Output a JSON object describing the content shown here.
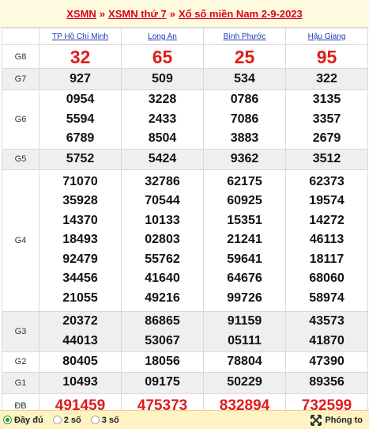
{
  "header": {
    "link1": "XSMN",
    "sep1": "»",
    "link2": "XSMN thứ 7",
    "sep2": "»",
    "link3": "Xổ số miền Nam 2-9-2023"
  },
  "provinces": [
    "TP Hồ Chí Minh",
    "Long An",
    "Bình Phước",
    "Hậu Giang"
  ],
  "prizes": [
    {
      "label": "G8",
      "rows": [
        [
          "32",
          "65",
          "25",
          "95"
        ]
      ]
    },
    {
      "label": "G7",
      "rows": [
        [
          "927",
          "509",
          "534",
          "322"
        ]
      ]
    },
    {
      "label": "G6",
      "rows": [
        [
          "0954",
          "3228",
          "0786",
          "3135"
        ],
        [
          "5594",
          "2433",
          "7086",
          "3357"
        ],
        [
          "6789",
          "8504",
          "3883",
          "2679"
        ]
      ]
    },
    {
      "label": "G5",
      "rows": [
        [
          "5752",
          "5424",
          "9362",
          "3512"
        ]
      ]
    },
    {
      "label": "G4",
      "rows": [
        [
          "71070",
          "32786",
          "62175",
          "62373"
        ],
        [
          "35928",
          "70544",
          "60925",
          "19574"
        ],
        [
          "14370",
          "10133",
          "15351",
          "14272"
        ],
        [
          "18493",
          "02803",
          "21241",
          "46113"
        ],
        [
          "92479",
          "55762",
          "59641",
          "18117"
        ],
        [
          "34456",
          "41640",
          "64676",
          "68060"
        ],
        [
          "21055",
          "49216",
          "99726",
          "58974"
        ]
      ]
    },
    {
      "label": "G3",
      "rows": [
        [
          "20372",
          "86865",
          "91159",
          "43573"
        ],
        [
          "44013",
          "53067",
          "05111",
          "41870"
        ]
      ]
    },
    {
      "label": "G2",
      "rows": [
        [
          "80405",
          "18056",
          "78804",
          "47390"
        ]
      ]
    },
    {
      "label": "G1",
      "rows": [
        [
          "10493",
          "09175",
          "50229",
          "89356"
        ]
      ]
    },
    {
      "label": "ĐB",
      "rows": [
        [
          "491459",
          "475373",
          "832894",
          "732599"
        ]
      ]
    }
  ],
  "footer": {
    "opt_full": "Đầy đủ",
    "opt_2": "2 số",
    "opt_3": "3 số",
    "zoom": "Phóng to"
  },
  "colors": {
    "accent_red": "#e21b1b",
    "link_blue": "#1a3bb0",
    "selected_green": "#2a9c2a"
  },
  "icons": {
    "zoom": "expand-arrows-icon"
  }
}
